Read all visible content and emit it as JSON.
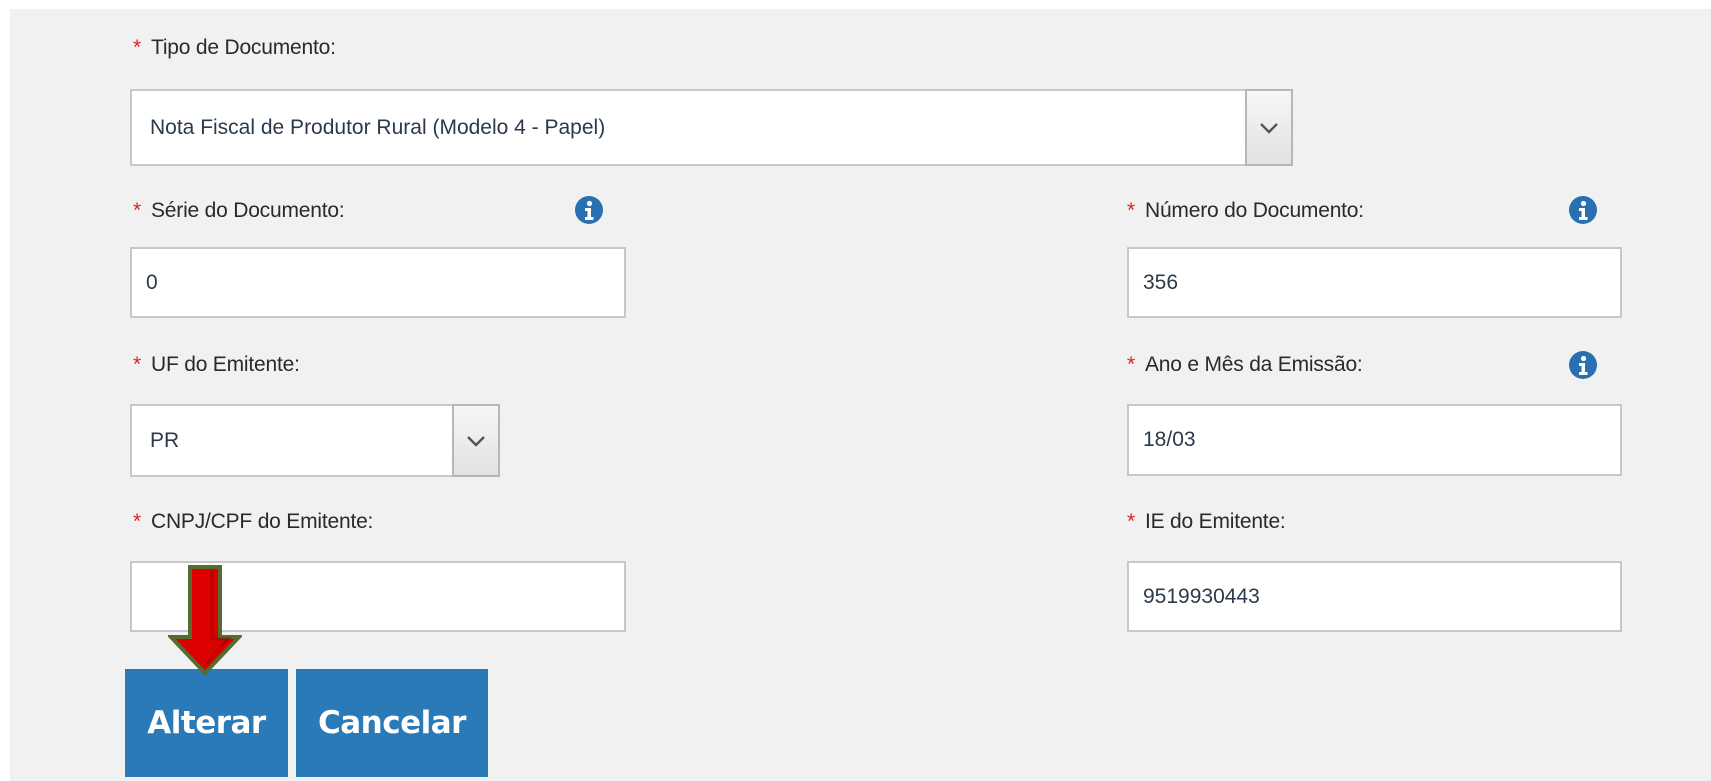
{
  "form": {
    "required_marker": "*",
    "tipo_documento": {
      "label": "Tipo de Documento:",
      "value": "Nota Fiscal de Produtor Rural (Modelo 4 - Papel)"
    },
    "serie_documento": {
      "label": "Série do Documento:",
      "value": "0"
    },
    "numero_documento": {
      "label": "Número do Documento:",
      "value": "356"
    },
    "uf_emitente": {
      "label": "UF do Emitente:",
      "value": "PR"
    },
    "ano_mes_emissao": {
      "label": "Ano e Mês da Emissão:",
      "value": "18/03"
    },
    "cnpj_cpf_emitente": {
      "label": "CNPJ/CPF do Emitente:",
      "value": ""
    },
    "ie_emitente": {
      "label": "IE do Emitente:",
      "value": "9519930443"
    }
  },
  "actions": {
    "alterar_label": "Alterar",
    "cancelar_label": "Cancelar"
  },
  "icons": {
    "info": "info-icon",
    "dropdown": "chevron-down-icon",
    "annotation_arrow": "arrow-down-icon"
  },
  "colors": {
    "required": "#e02020",
    "button": "#2a7ab8",
    "info_icon": "#2a6fb0",
    "annotation_arrow": "#dd0000"
  }
}
